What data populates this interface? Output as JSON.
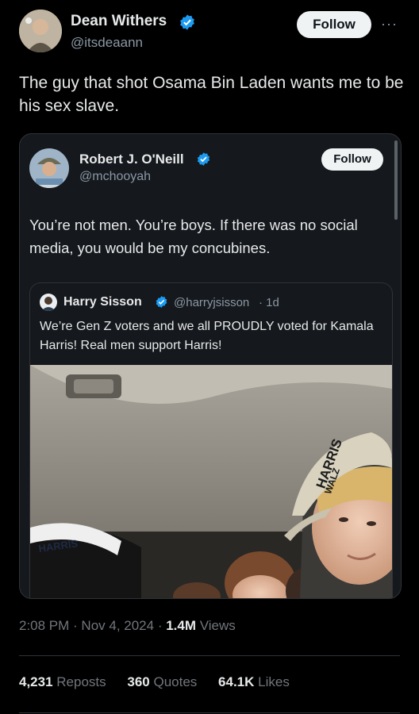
{
  "main_tweet": {
    "author_name": "Dean Withers",
    "author_handle": "@itsdeaann",
    "follow_label": "Follow",
    "more_label": "···",
    "text": "The guy that shot Osama Bin Laden wants me to be his sex slave."
  },
  "quoted_tweet": {
    "author_name": "Robert J. O'Neill",
    "author_handle": "@mchooyah",
    "follow_label": "Follow",
    "text": "You’re not men. You’re boys. If there was no social media, you would be my concubines."
  },
  "nested_quote": {
    "author_name": "Harry Sisson",
    "author_handle": "@harryjsisson",
    "time": "· 1d",
    "text": "We’re Gen Z voters and we all PROUDLY voted for Kamala Harris! Real men support Harris!",
    "hat_text_right_line1": "HARRIS",
    "hat_text_right_line2": "WALZ",
    "hat_text_left": "HARRIS"
  },
  "meta": {
    "time": "2:08 PM · Nov 4, 2024 ·",
    "views_count": "1.4M",
    "views_label": "Views"
  },
  "stats": {
    "reposts_count": "4,231",
    "reposts_label": "Reposts",
    "quotes_count": "360",
    "quotes_label": "Quotes",
    "likes_count": "64.1K",
    "likes_label": "Likes"
  },
  "colors": {
    "verified": "#1d9bf0",
    "background": "#000000",
    "card": "#15181c"
  },
  "icons": [
    "verified-badge-icon",
    "more-icon"
  ]
}
